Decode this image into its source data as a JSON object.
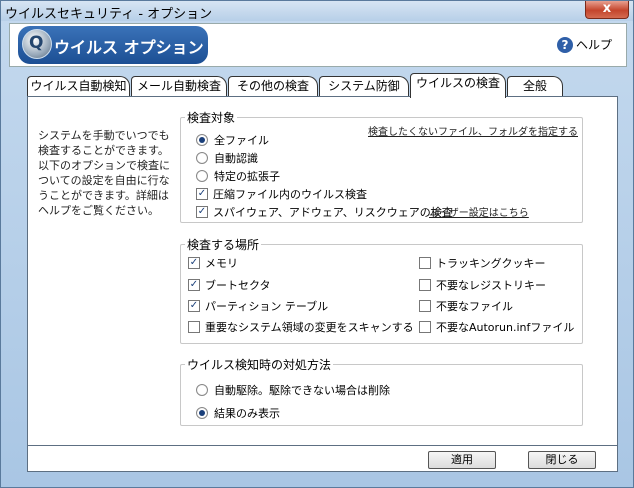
{
  "window": {
    "title": "ウイルスセキュリティ - オプション",
    "close_label": "x"
  },
  "header": {
    "logo_glyph": "Q",
    "title": "ウイルス オプション",
    "help_label": "ヘルプ",
    "help_glyph": "?"
  },
  "tabs": [
    {
      "label": "ウイルス自動検知",
      "active": false
    },
    {
      "label": "メール自動検査",
      "active": false
    },
    {
      "label": "その他の検査",
      "active": false
    },
    {
      "label": "システム防御",
      "active": false
    },
    {
      "label": "ウイルスの検査",
      "active": true
    },
    {
      "label": "全般",
      "active": false
    }
  ],
  "side_description": "システムを手動でいつでも検査することができます。以下のオプションで検査についての設定を自由に行なうことができます。詳細はヘルプをご覧ください。",
  "scan_target": {
    "legend": "検査対象",
    "exclude_link": "検査したくないファイル、フォルダを指定する",
    "user_setting_link": "ユーザー設定はこちら",
    "radios": [
      {
        "label": "全ファイル",
        "selected": true
      },
      {
        "label": "自動認識",
        "selected": false
      },
      {
        "label": "特定の拡張子",
        "selected": false
      }
    ],
    "checks": [
      {
        "label": "圧縮ファイル内のウイルス検査",
        "checked": true
      },
      {
        "label": "スパイウェア、アドウェア、リスクウェアの検査",
        "checked": true
      }
    ]
  },
  "scan_locations": {
    "legend": "検査する場所",
    "left": [
      {
        "label": "メモリ",
        "checked": true
      },
      {
        "label": "ブートセクタ",
        "checked": true
      },
      {
        "label": "パーティション テーブル",
        "checked": true
      },
      {
        "label": "重要なシステム領域の変更をスキャンする",
        "checked": false
      }
    ],
    "right": [
      {
        "label": "トラッキングクッキー",
        "checked": false
      },
      {
        "label": "不要なレジストリキー",
        "checked": false
      },
      {
        "label": "不要なファイル",
        "checked": false
      },
      {
        "label": "不要なAutorun.infファイル",
        "checked": false
      }
    ]
  },
  "on_detect": {
    "legend": "ウイルス検知時の対処方法",
    "radios": [
      {
        "label": "自動駆除。駆除できない場合は削除",
        "selected": false
      },
      {
        "label": "結果のみ表示",
        "selected": true
      }
    ]
  },
  "buttons": {
    "apply": "適用",
    "close": "閉じる"
  },
  "check_glyph": "✓"
}
